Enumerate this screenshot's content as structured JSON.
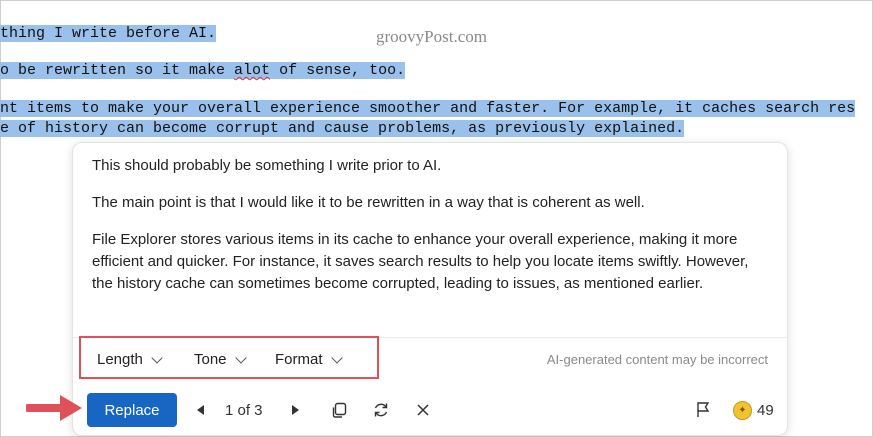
{
  "editor": {
    "watermark": "groovyPost.com",
    "line1": "thing I write before AI.",
    "line2_pre": "o be rewritten so it make ",
    "line2_misspelled": "alot",
    "line2_post": " of sense, too.",
    "line3": "nt items to make your overall experience smoother and faster. For example, it caches search res",
    "line4": "e of history can become corrupt and cause problems, as previously explained."
  },
  "panel": {
    "paragraphs": [
      "This should probably be something I write prior to AI.",
      "The main point is that I would like it to be rewritten in a way that is coherent as well.",
      "File Explorer stores various items in its cache to enhance your overall experience, making it more efficient and quicker. For instance, it saves search results to help you locate items swiftly. However, the history cache can sometimes become corrupted, leading to issues, as mentioned earlier."
    ],
    "options": {
      "length": "Length",
      "tone": "Tone",
      "format": "Format"
    },
    "disclaimer": "AI-generated content may be incorrect"
  },
  "toolbar": {
    "replace_label": "Replace",
    "pager": "1 of 3",
    "credits": "49"
  },
  "icons": [
    "previous-icon",
    "next-icon",
    "copy-icon",
    "regenerate-icon",
    "close-icon",
    "flag-icon",
    "credits-icon",
    "arrow-annotation"
  ],
  "colors": {
    "selection": "#99c1ec",
    "accent": "#1766c4",
    "annotation": "#e0505a"
  }
}
